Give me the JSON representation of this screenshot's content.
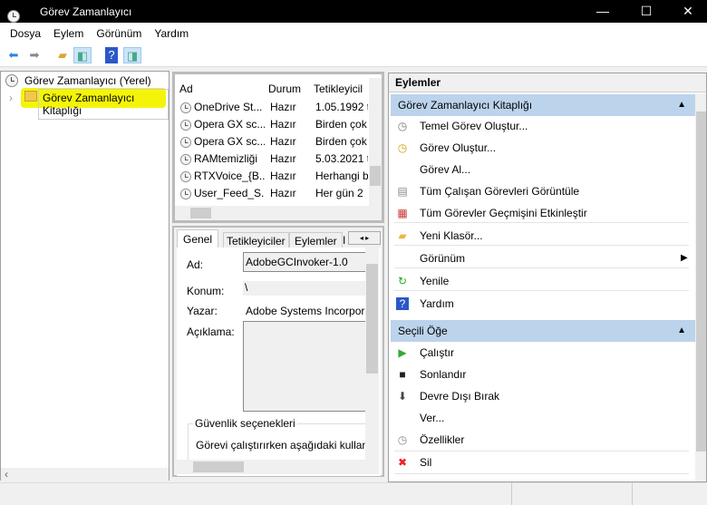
{
  "window": {
    "title": "Görev Zamanlayıcı",
    "minimize": "—",
    "maximize": "☐",
    "close": "✕"
  },
  "menu": [
    "Dosya",
    "Eylem",
    "Görünüm",
    "Yardım"
  ],
  "tree": {
    "root": "Görev Zamanlayıcı (Yerel)",
    "child": "Görev Zamanlayıcı Kitaplığı"
  },
  "tasks": {
    "columns": [
      "Ad",
      "Durum",
      "Tetikleyicil"
    ],
    "rows": [
      [
        "OneDrive St...",
        "Hazır",
        "1.05.1992 t"
      ],
      [
        "Opera GX sc...",
        "Hazır",
        "Birden çok"
      ],
      [
        "Opera GX sc...",
        "Hazır",
        "Birden çok"
      ],
      [
        "RAMtemizliği",
        "Hazır",
        "5.03.2021 t"
      ],
      [
        "RTXVoice_{B...",
        "Hazır",
        "Herhangi b"
      ],
      [
        "User_Feed_S...",
        "Hazır",
        "Her gün 2"
      ]
    ]
  },
  "details": {
    "tabs": [
      "Genel",
      "Tetikleyiciler",
      "Eylemler",
      "I"
    ],
    "name_label": "Ad:",
    "name_value": "AdobeGCInvoker-1.0",
    "location_label": "Konum:",
    "location_value": "\\",
    "author_label": "Yazar:",
    "author_value": "Adobe Systems Incorpor",
    "description_label": "Açıklama:",
    "security_title": "Güvenlik seçenekleri",
    "security_text": "Görevi çalıştırırken aşağıdaki kullanı"
  },
  "actions": {
    "header": "Eylemler",
    "section1": "Görev Zamanlayıcı Kitaplığı",
    "items1": [
      "Temel Görev Oluştur...",
      "Görev Oluştur...",
      "Görev Al...",
      "Tüm Çalışan Görevleri Görüntüle",
      "Tüm Görevler Geçmişini Etkinleştir",
      "Yeni Klasör...",
      "Görünüm",
      "Yenile",
      "Yardım"
    ],
    "section2": "Seçili Öğe",
    "items2": [
      "Çalıştır",
      "Sonlandır",
      "Devre Dışı Bırak",
      "Ver...",
      "Özellikler",
      "Sil"
    ]
  },
  "colors": {
    "highlight": "#f4f40a",
    "section": "#bcd3ec"
  }
}
